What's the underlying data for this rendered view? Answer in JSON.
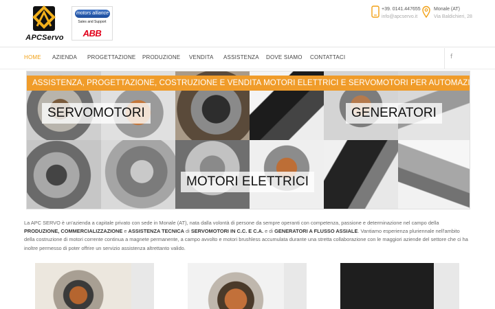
{
  "header": {
    "logo_text": "APCServo",
    "partner": {
      "brand": "motors alliance",
      "tagline": "Sales and Support",
      "abb": "ABB"
    },
    "phone": "+39. 0141.447655",
    "email": "info@apcservo.it",
    "city": "Monale (AT)",
    "street": "Via Baldichieri, 28"
  },
  "nav": {
    "items": [
      "HOME",
      "AZIENDA",
      "PROGETTAZIONE",
      "PRODUZIONE",
      "VENDITA",
      "ASSISTENZA",
      "DOVE SIAMO",
      "CONTATTACI"
    ],
    "social_icon": "facebook-icon",
    "social_glyph": "f"
  },
  "banner": {
    "strip": "ASSISTENZA, PROGETTAZIONE, COSTRUZIONE E VENDITA MOTORI ELETTRICI E SERVOMOTORI PER AUTOMAZIONE INDUSTRIALE",
    "label_servomotori": "SERVOMOTORI",
    "label_generatori": "GENERATORI",
    "label_motori": "MOTORI ELETTRICI"
  },
  "intro": {
    "p1": "La APC SERVO è un'azienda a capitale privato con sede in Monale (AT), nata dalla volontà di persone da sempre operanti con competenza, passione e determinazione nel campo della ",
    "b1": "PRODUZIONE, COMMERCIALIZZAZIONE",
    "p2": " e ",
    "b2": "ASSISTENZA TECNICA",
    "p3": " di ",
    "b3": "SERVOMOTORI IN C.C. E C.A.",
    "p4": " e di ",
    "b4": "GENERATORI A FLUSSO ASSIALE",
    "p5": ". Vantiamo esperienza pluriennale nell'ambito della costruzione di motori corrente continua a magnete permanente, a campo avvolto e motori brushless accumulata durante una stretta collaborazione con le maggiori aziende del settore che ci ha inoltre permesso di poter offrire un servizio assistenza altrettanto valido."
  },
  "colors": {
    "accent": "#f2a014",
    "banner_strip": "#f09c2a",
    "abb_red": "#e1001a"
  }
}
